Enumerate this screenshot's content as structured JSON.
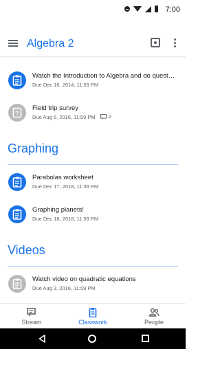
{
  "status": {
    "time": "7:00"
  },
  "header": {
    "title": "Algebra 2"
  },
  "items_top": [
    {
      "title": "Watch the Introduction to Algebra and do quest…",
      "meta": "Due Dec 16, 2014, 11:59 PM",
      "color": "blue"
    },
    {
      "title": "Field trip survey",
      "meta": "Due Aug 6, 2016, 11:59 PM",
      "comments": "2",
      "color": "gray"
    }
  ],
  "sections": [
    {
      "title": "Graphing",
      "items": [
        {
          "title": "Parabolas worksheet",
          "meta": "Due Dec 17, 2018, 11:59 PM",
          "color": "blue"
        },
        {
          "title": "Graphing planets!",
          "meta": "Due Dec 18, 2018, 11:59 PM",
          "color": "blue"
        }
      ]
    },
    {
      "title": "Videos",
      "items": [
        {
          "title": "Watch video on quadratic equations",
          "meta": "Due Aug 3, 2016, 11:59 PM",
          "color": "gray"
        }
      ]
    }
  ],
  "bottom_nav": {
    "stream": "Stream",
    "classwork": "Classwork",
    "people": "People"
  },
  "colors": {
    "accent": "#1a73e8",
    "gray_icon": "#b9b9b9",
    "divider": "#aecbfa"
  }
}
